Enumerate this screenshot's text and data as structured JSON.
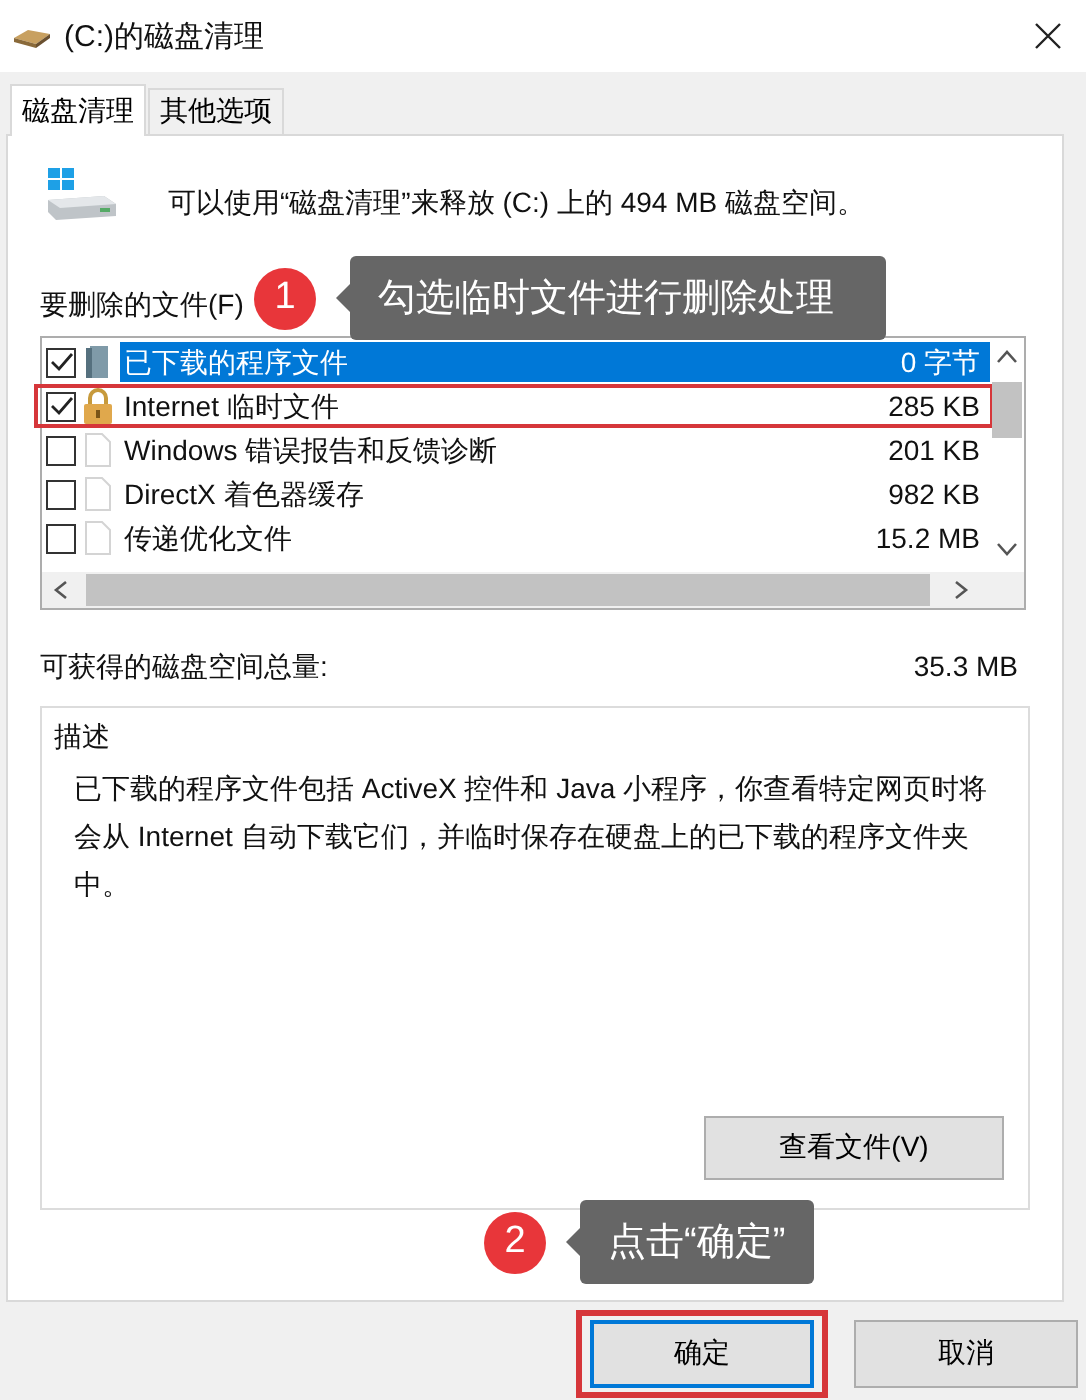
{
  "window": {
    "title": "(C:)的磁盘清理"
  },
  "tabs": [
    {
      "label": "磁盘清理",
      "selected": true
    },
    {
      "label": "其他选项",
      "selected": false
    }
  ],
  "header": {
    "text": "可以使用“磁盘清理”来释放 (C:) 上的 494 MB 磁盘空间。"
  },
  "files": {
    "label": "要删除的文件(F)",
    "items": [
      {
        "kind": "program",
        "name": "已下载的程序文件",
        "size": "0 字节",
        "checked": true,
        "selected": true,
        "highlighted": false
      },
      {
        "kind": "lock",
        "name": "Internet 临时文件",
        "size": "285 KB",
        "checked": true,
        "selected": false,
        "highlighted": true
      },
      {
        "kind": "document",
        "name": "Windows 错误报告和反馈诊断",
        "size": "201 KB",
        "checked": false,
        "selected": false,
        "highlighted": false
      },
      {
        "kind": "document",
        "name": "DirectX 着色器缓存",
        "size": "982 KB",
        "checked": false,
        "selected": false,
        "highlighted": false
      },
      {
        "kind": "document",
        "name": "传递优化文件",
        "size": "15.2 MB",
        "checked": false,
        "selected": false,
        "highlighted": false
      }
    ]
  },
  "total": {
    "label": "可获得的磁盘空间总量:",
    "value": "35.3 MB"
  },
  "description": {
    "title": "描述",
    "text": "已下载的程序文件包括 ActiveX 控件和 Java 小程序，你查看特定网页时将会从 Internet 自动下载它们，并临时保存在硬盘上的已下载的程序文件夹中。",
    "button": "查看文件(V)"
  },
  "buttons": [
    {
      "label": "确定",
      "default": true,
      "highlighted": true
    },
    {
      "label": "取消",
      "default": false,
      "highlighted": false
    }
  ],
  "annotations": [
    {
      "number": "1",
      "text": "勾选临时文件进行删除处理"
    },
    {
      "number": "2",
      "text": "点击“确定”"
    }
  ]
}
